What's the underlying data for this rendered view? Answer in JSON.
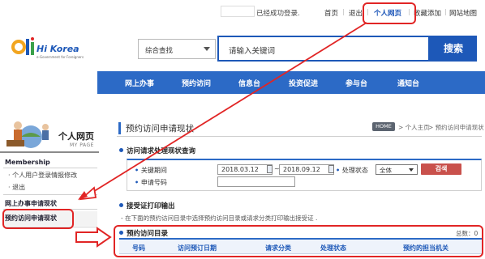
{
  "topbar": {
    "login_status": "已经成功登录.",
    "links": [
      "首页",
      "退出",
      "个人网页",
      "收藏添加",
      "网站地图"
    ]
  },
  "header": {
    "logo_text": "Hi Korea",
    "logo_tagline": "e-Government for Foreigners",
    "search_scope": "综合查找",
    "search_placeholder": "请输入关键词",
    "search_button": "搜索"
  },
  "nav": [
    "网上办事",
    "预约访问",
    "信息台",
    "投资促进",
    "参与台",
    "通知台"
  ],
  "sidebar": {
    "title": "个人网页",
    "subtitle": "MY PAGE",
    "section_membership": "Membership",
    "item_edit": "· 个人用户登录情报修改",
    "item_logout": "· 退出",
    "section_online": "网上办事申请现状",
    "section_visit": "预约访问申请现状"
  },
  "main": {
    "title": "预约访问申请现状",
    "breadcrumb_home": "HOME",
    "breadcrumb": [
      "> 个人主页",
      "> 预约访问申请现状"
    ],
    "query_heading": "访问请求处理现状查询",
    "period_label": "关键期间",
    "date_from": "2018.03.12",
    "date_to": "2018.09.12",
    "status_label": "处理状态",
    "status_value": "全体",
    "search_button": "검색",
    "app_no_label": "申请号码",
    "print_heading": "接受证打印输出",
    "notice": "- 在下面的预约访问目录中选择预约访问目录或请求分类打印输出接受证 .",
    "list_heading": "预约访问目录",
    "total_label": "总数：0",
    "columns": [
      "号码",
      "访问预订日期",
      "请求分类",
      "处理状态",
      "预约的担当机关"
    ]
  },
  "colors": {
    "brand_blue": "#1d58b8",
    "nav_blue": "#2c6ac6",
    "annotation_red": "#e12525",
    "search_red": "#c9514c"
  }
}
